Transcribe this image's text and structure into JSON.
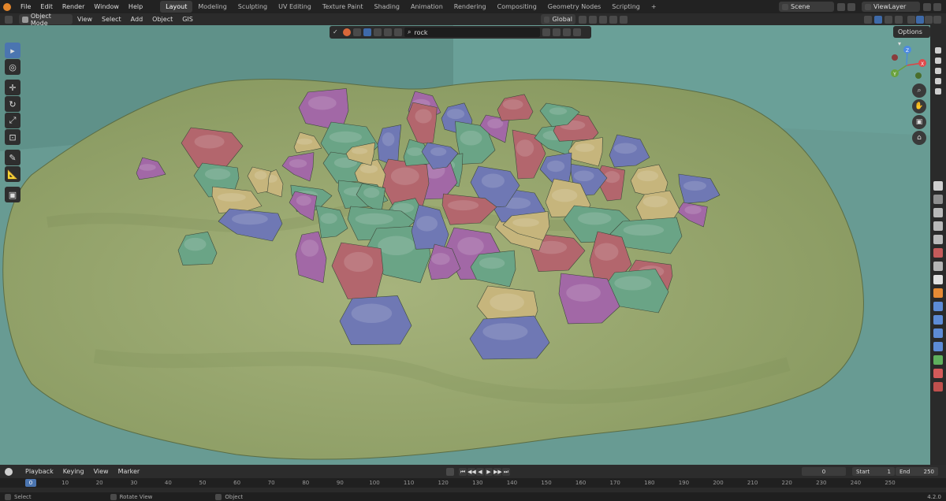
{
  "menubar": {
    "menus": [
      "File",
      "Edit",
      "Render",
      "Window",
      "Help"
    ],
    "workspaces": [
      "Layout",
      "Modeling",
      "Sculpting",
      "UV Editing",
      "Texture Paint",
      "Shading",
      "Animation",
      "Rendering",
      "Compositing",
      "Geometry Nodes",
      "Scripting"
    ],
    "add_tab": "+",
    "scene": "Scene",
    "view_layer": "ViewLayer"
  },
  "header": {
    "mode": "Object Mode",
    "menus": [
      "View",
      "Select",
      "Add",
      "Object",
      "GIS"
    ],
    "orientation": "Global"
  },
  "outliner_search": {
    "value": "rock"
  },
  "viewport": {
    "options_label": "Options",
    "gizmo_axes": {
      "x": "X",
      "y": "Y",
      "z": "Z"
    },
    "colors": {
      "ground": "#8d9f6a",
      "background": "#689b93",
      "rock_blue": "#6f78b4",
      "rock_red": "#b3666d",
      "rock_green": "#6aa486",
      "rock_purple": "#a268a6",
      "rock_tan": "#c6b57c"
    }
  },
  "timeline": {
    "menus": [
      "Playback",
      "Keying",
      "View",
      "Marker"
    ],
    "current_frame": "0",
    "start_label": "Start",
    "start_value": "1",
    "end_label": "End",
    "end_value": "250",
    "ruler": [
      "0",
      "10",
      "20",
      "30",
      "40",
      "50",
      "60",
      "70",
      "80",
      "90",
      "100",
      "110",
      "120",
      "130",
      "140",
      "150",
      "160",
      "170",
      "180",
      "190",
      "200",
      "210",
      "220",
      "230",
      "240",
      "250"
    ]
  },
  "statusbar": {
    "items": [
      "Select",
      "Rotate View",
      "Object"
    ],
    "version": "4.2.0"
  }
}
